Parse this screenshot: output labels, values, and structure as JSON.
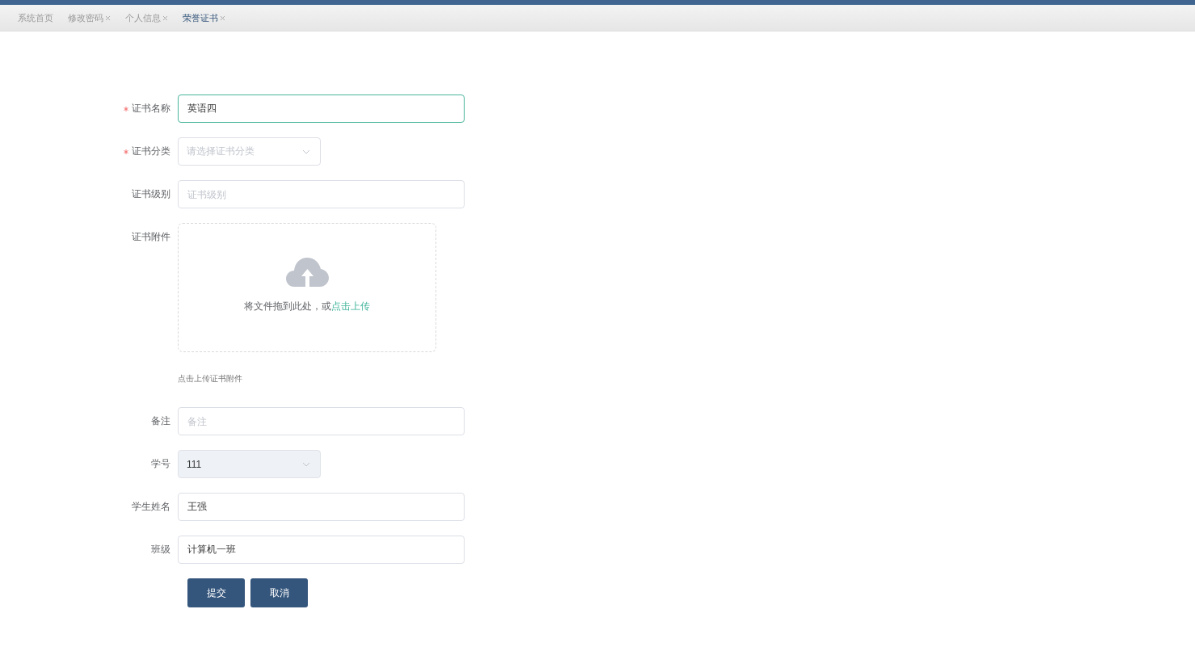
{
  "tabs": [
    {
      "label": "系统首页",
      "closable": false,
      "selected": false
    },
    {
      "label": "修改密码",
      "closable": true,
      "selected": false
    },
    {
      "label": "个人信息",
      "closable": true,
      "selected": false
    },
    {
      "label": "荣誉证书",
      "closable": true,
      "selected": true
    }
  ],
  "form": {
    "fields": [
      {
        "kind": "input",
        "label": "证书名称",
        "required": true,
        "value": "英语四",
        "focused": true
      },
      {
        "kind": "select",
        "label": "证书分类",
        "required": true,
        "placeholder": "请选择证书分类",
        "disabled": false
      },
      {
        "kind": "input",
        "label": "证书级别",
        "required": false,
        "placeholder": "证书级别",
        "focused": false
      },
      {
        "kind": "upload",
        "label": "证书附件",
        "required": false,
        "prompt": "将文件拖到此处，或",
        "link": "点击上传",
        "hint": "点击上传证书附件"
      },
      {
        "kind": "input",
        "label": "备注",
        "required": false,
        "placeholder": "备注",
        "focused": false
      },
      {
        "kind": "select",
        "label": "学号",
        "required": false,
        "value": "111",
        "disabled": true
      },
      {
        "kind": "input",
        "label": "学生姓名",
        "required": false,
        "value": "王强",
        "focused": false
      },
      {
        "kind": "input",
        "label": "班级",
        "required": false,
        "value": "计算机一班",
        "focused": false
      }
    ],
    "buttons": [
      "提交",
      "取消"
    ]
  }
}
